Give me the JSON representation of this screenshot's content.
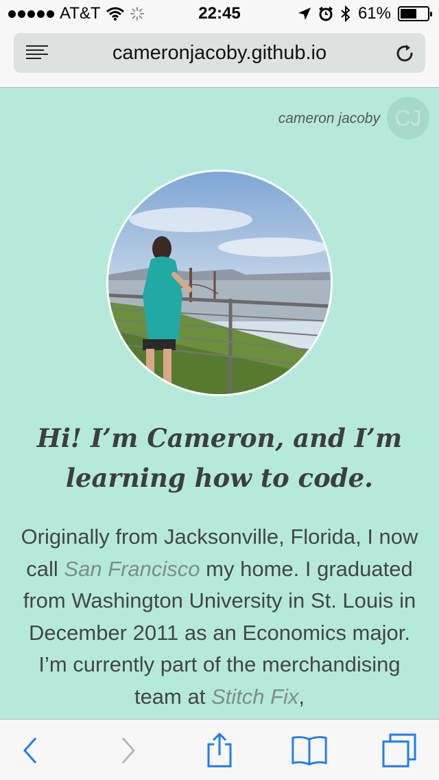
{
  "status_bar": {
    "carrier": "AT&T",
    "time": "22:45",
    "battery_percent": "61%",
    "battery_level": 0.61,
    "icons": [
      "signal-dots-icon",
      "wifi-icon",
      "loading-spinner-icon",
      "location-arrow-icon",
      "alarm-icon",
      "bluetooth-icon",
      "battery-icon"
    ]
  },
  "browser": {
    "url": "cameronjacoby.github.io",
    "reader_icon": "reader-mode-icon",
    "reload_icon": "reload-icon"
  },
  "page": {
    "brand_name": "cameron jacoby",
    "brand_logo_text": "CJ",
    "headline": "Hi! I’m Cameron, and I’m learning how to code.",
    "bio_parts": {
      "p1": "Originally from Jacksonville, Florida, I now call ",
      "link1": "San Francisco",
      "p2": " my home. I graduated from Washington University in St. Louis in December 2011 as an Economics major. I’m currently part of the merchandising team at ",
      "link2": "Stitch Fix",
      "p3": ","
    }
  },
  "toolbar": {
    "items": [
      "back-icon",
      "forward-icon",
      "share-icon",
      "bookmarks-icon",
      "tabs-icon"
    ]
  },
  "colors": {
    "page_background": "#b5eadb",
    "accent_blue": "#1a7cf2",
    "link_gray": "#7b8f89"
  }
}
